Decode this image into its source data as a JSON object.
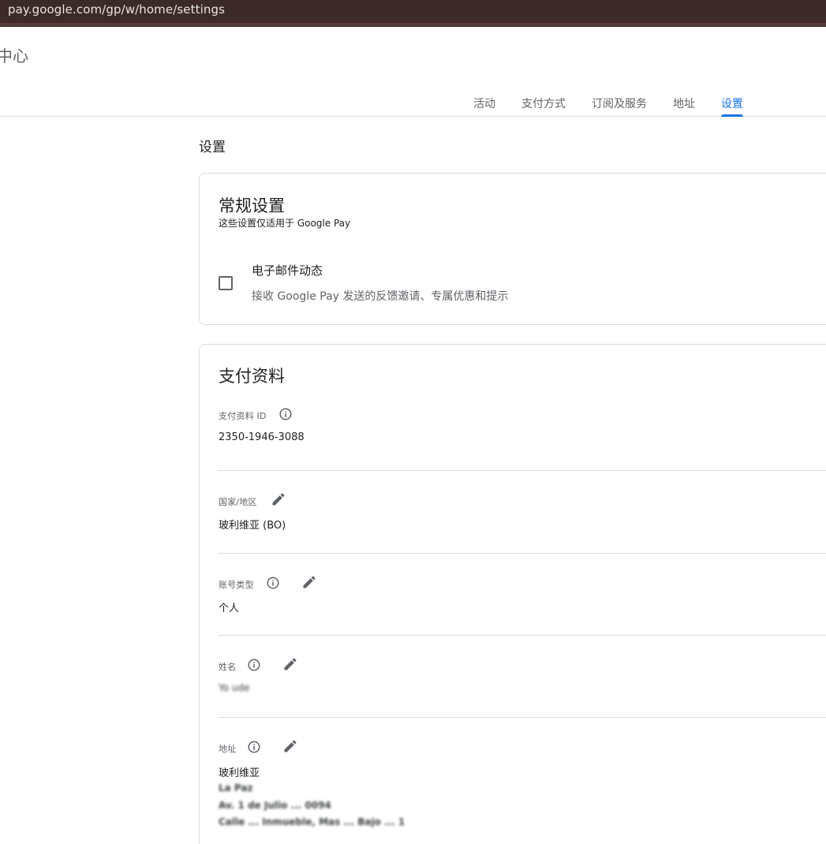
{
  "browser": {
    "url": "pay.google.com/gp/w/home/settings"
  },
  "header": {
    "app_title": "中心"
  },
  "tabs": [
    {
      "label": "活动"
    },
    {
      "label": "支付方式"
    },
    {
      "label": "订阅及服务"
    },
    {
      "label": "地址"
    },
    {
      "label": "设置",
      "active": true
    }
  ],
  "page": {
    "heading": "设置"
  },
  "general_settings": {
    "title": "常规设置",
    "subtitle": "这些设置仅适用于 Google Pay",
    "email_option": {
      "checked": false,
      "title": "电子邮件动态",
      "description": "接收 Google Pay 发送的反馈邀请、专属优惠和提示"
    }
  },
  "payment_profile": {
    "title": "支付资料",
    "fields": {
      "profile_id": {
        "label": "支付资料 ID",
        "value": "2350-1946-3088"
      },
      "country": {
        "label": "国家/地区",
        "value": "玻利维亚 (BO)"
      },
      "account_type": {
        "label": "账号类型",
        "value": "个人"
      },
      "name": {
        "label": "姓名",
        "value": "Yo ude"
      },
      "address": {
        "label": "地址",
        "value": "玻利维亚",
        "lines": [
          "La Paz",
          "Av. 1 de Julio ... 0094",
          "Calle ... Inmueble, Mas ... Bajo ... 1"
        ]
      }
    }
  },
  "colors": {
    "accent": "#1a73e8",
    "urlbar_bg": "#3c2a28",
    "divider": "#dadce0",
    "muted_text": "#5f6368"
  },
  "icons": {
    "info": "info-circle-icon",
    "edit": "pencil-icon"
  }
}
